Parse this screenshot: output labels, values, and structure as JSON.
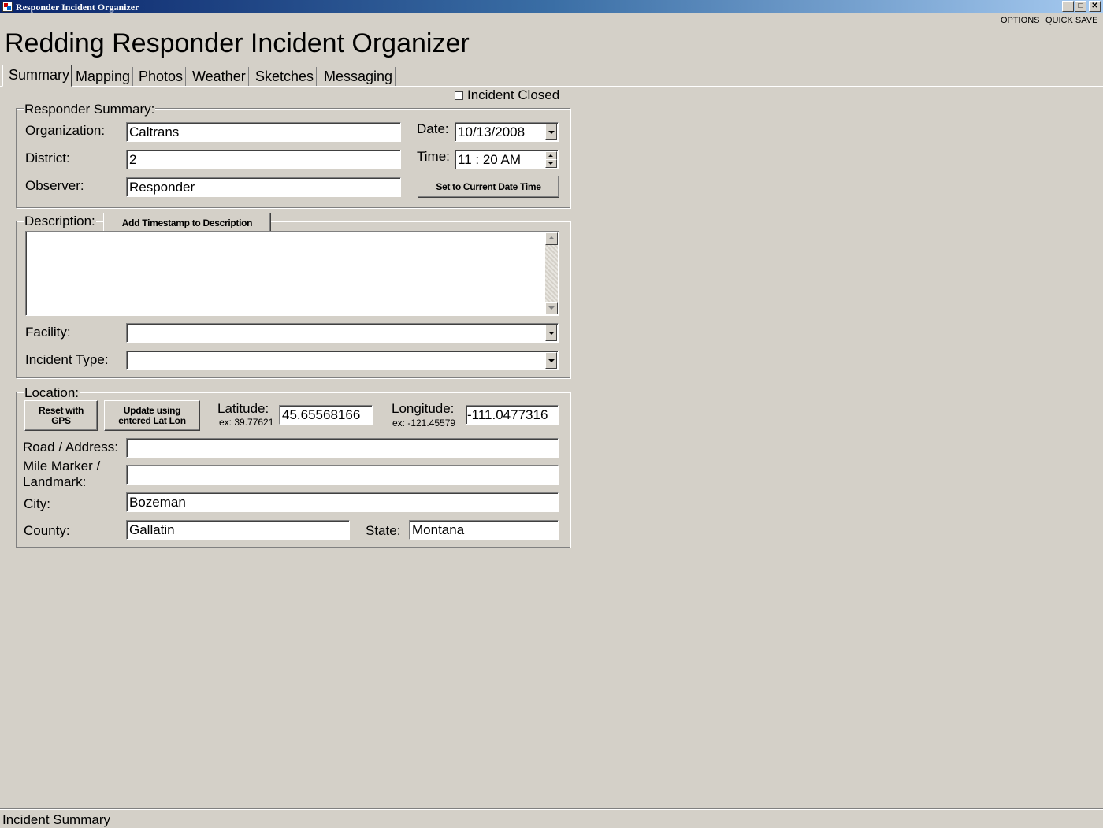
{
  "window": {
    "title": "Responder Incident Organizer",
    "controls": {
      "minimize": "_",
      "maximize": "□",
      "close": "✕"
    }
  },
  "menu": {
    "options": "OPTIONS",
    "quick_save": "QUICK SAVE"
  },
  "heading": "Redding Responder Incident Organizer",
  "tabs": [
    {
      "label": "Summary",
      "active": true
    },
    {
      "label": "Mapping"
    },
    {
      "label": "Photos"
    },
    {
      "label": "Weather"
    },
    {
      "label": "Sketches"
    },
    {
      "label": "Messaging"
    }
  ],
  "incident_closed": {
    "label": "Incident Closed",
    "checked": false
  },
  "responder_summary": {
    "title": "Responder Summary:",
    "organization_label": "Organization:",
    "organization_value": "Caltrans",
    "district_label": "District:",
    "district_value": "2",
    "observer_label": "Observer:",
    "observer_value": "Responder",
    "date_label": "Date:",
    "date_value": "10/13/2008",
    "time_label": "Time:",
    "time_value": "11 : 20 AM",
    "set_current_button": "Set to Current Date Time"
  },
  "description": {
    "title": "Description:",
    "timestamp_button": "Add Timestamp to Description",
    "text": "",
    "facility_label": "Facility:",
    "facility_value": "",
    "incident_type_label": "Incident Type:",
    "incident_type_value": ""
  },
  "location": {
    "title": "Location:",
    "reset_gps_button": "Reset with GPS",
    "update_latlon_button": "Update using entered Lat Lon",
    "latitude_label": "Latitude:",
    "latitude_example": "ex: 39.77621",
    "latitude_value": "45.65568166",
    "longitude_label": "Longitude:",
    "longitude_example": "ex: -121.45579",
    "longitude_value": "-111.0477316",
    "road_label": "Road / Address:",
    "road_value": "",
    "mile_marker_label_1": "Mile Marker /",
    "mile_marker_label_2": "Landmark:",
    "mile_marker_value": "",
    "city_label": "City:",
    "city_value": "Bozeman",
    "county_label": "County:",
    "county_value": "Gallatin",
    "state_label": "State:",
    "state_value": "Montana"
  },
  "status_bar": "Incident Summary"
}
